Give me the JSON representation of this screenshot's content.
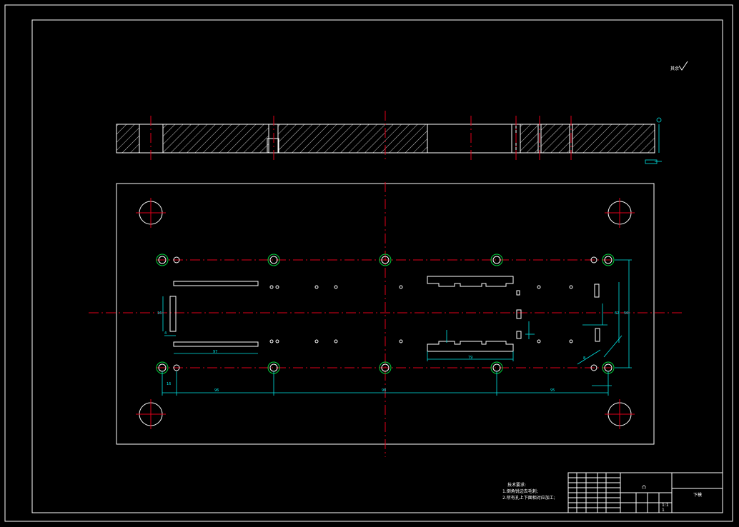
{
  "drawing": {
    "roughness_symbol": "其余",
    "tech_notes": {
      "title": "技术要求:",
      "line1": "1.倒角锐边去毛刺;",
      "line2": "2.所有孔上下面相对应加工;"
    },
    "dims": {
      "top_left": "16",
      "total_width": "96",
      "center_width": "98",
      "right_width": "95",
      "bottom_bar": "97",
      "left_height": "16",
      "right_height": "50",
      "right_height2": "62",
      "slot_width": "79",
      "small": "4",
      "right_note": "8"
    },
    "title_block": {
      "part_name": "凸",
      "drawing_no": "下模",
      "scale": "1:1",
      "sheet": "1"
    },
    "colors": {
      "background": "#000000",
      "outline": "#ffffff",
      "centerline": "#e0001a",
      "dimension": "#00e5e5",
      "pilot_hole": "#00d23c"
    }
  }
}
